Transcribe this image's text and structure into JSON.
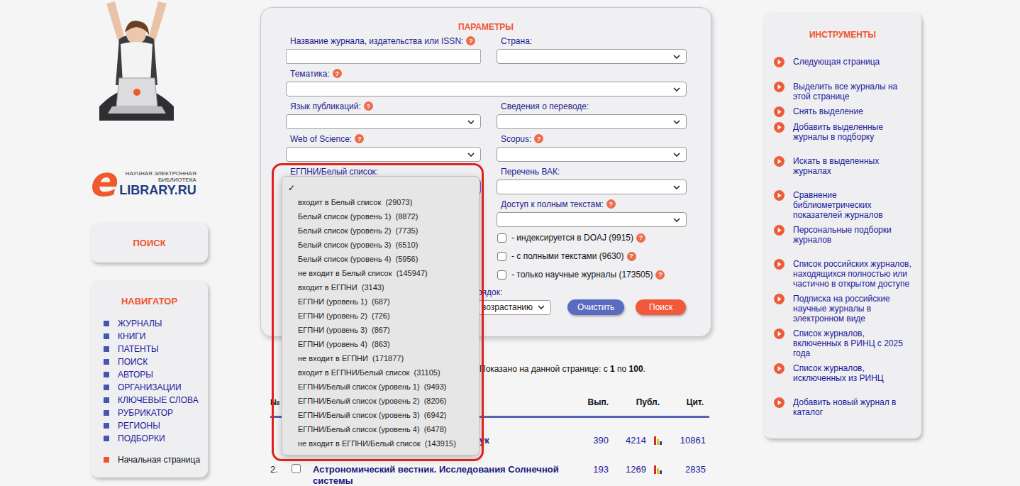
{
  "logo": {
    "letter": "e",
    "tagline": [
      "НАУЧНАЯ ЭЛЕКТРОННАЯ",
      "БИБЛИОТЕКА"
    ],
    "name": "LIBRARY.RU"
  },
  "search_panel": {
    "label": "ПОИСК"
  },
  "navigator": {
    "title": "НАВИГАТОР",
    "items": [
      "ЖУРНАЛЫ",
      "КНИГИ",
      "ПАТЕНТЫ",
      "ПОИСК",
      "АВТОРЫ",
      "ОРГАНИЗАЦИИ",
      "КЛЮЧЕВЫЕ СЛОВА",
      "РУБРИКАТОР",
      "РЕГИОНЫ",
      "ПОДБОРКИ"
    ],
    "home": "Начальная страница"
  },
  "parameters": {
    "title": "ПАРАМЕТРЫ",
    "help_icon": "?",
    "rows": [
      [
        {
          "label": "Название журнала, издательства или ISSN:",
          "help": true,
          "kind": "input",
          "value": "",
          "expanded": false
        },
        {
          "label": "Страна:",
          "help": false,
          "kind": "select",
          "value": "",
          "expanded": false
        }
      ],
      [
        {
          "label": "Тематика:",
          "help": true,
          "kind": "select",
          "value": "",
          "expanded": false
        }
      ],
      [
        {
          "label": "Язык публикаций:",
          "help": true,
          "kind": "select",
          "value": "",
          "expanded": false
        },
        {
          "label": "Сведения о переводе:",
          "help": false,
          "kind": "select",
          "value": "",
          "expanded": false
        }
      ],
      [
        {
          "label": "Web of Science:",
          "help": true,
          "kind": "select",
          "value": "",
          "expanded": false
        },
        {
          "label": "Scopus:",
          "help": true,
          "kind": "select",
          "value": "",
          "expanded": false
        }
      ],
      [
        {
          "label": "ЕГПНИ/Белый список:",
          "help": false,
          "kind": "select",
          "value": "",
          "expanded": true
        },
        {
          "label": "Перечень ВАК:",
          "help": false,
          "kind": "select",
          "value": "",
          "expanded": false
        }
      ],
      [
        null,
        {
          "label": "Доступ к полным текстам:",
          "help": true,
          "kind": "select",
          "value": "",
          "expanded": false
        }
      ]
    ],
    "checkboxes": [
      {
        "label": "- индексируется в DOAJ (9915)",
        "checked": false,
        "help": true
      },
      {
        "label": "- с полными текстами (9630)",
        "checked": false,
        "help": true
      },
      {
        "label": "- только научные журналы (173505)",
        "checked": false,
        "help": true
      }
    ],
    "sort": {
      "label": "рядок:",
      "value": "о возрастанию"
    },
    "buttons": [
      {
        "label": "Очистить",
        "color": "#5a6cc0"
      },
      {
        "label": "Поиск",
        "color": "#f2593a"
      }
    ]
  },
  "dropdown": {
    "check": "✓",
    "options": [
      {
        "label": "",
        "selected": true
      },
      {
        "label": "входит в Белый список  (29073)",
        "selected": false
      },
      {
        "label": "Белый список (уровень 1)  (8872)",
        "selected": false
      },
      {
        "label": "Белый список (уровень 2)  (7735)",
        "selected": false
      },
      {
        "label": "Белый список (уровень 3)  (6510)",
        "selected": false
      },
      {
        "label": "Белый список (уровень 4)  (5956)",
        "selected": false
      },
      {
        "label": "не входит в Белый список  (145947)",
        "selected": false
      },
      {
        "label": "входит в ЕГПНИ  (3143)",
        "selected": false
      },
      {
        "label": "ЕГПНИ (уровень 1)  (687)",
        "selected": false
      },
      {
        "label": "ЕГПНИ (уровень 2)  (726)",
        "selected": false
      },
      {
        "label": "ЕГПНИ (уровень 3)  (867)",
        "selected": false
      },
      {
        "label": "ЕГПНИ (уровень 4)  (863)",
        "selected": false
      },
      {
        "label": "не входит в ЕГПНИ  (171877)",
        "selected": false
      },
      {
        "label": "входит в ЕГПНИ/Белый список  (31105)",
        "selected": false
      },
      {
        "label": "ЕГПНИ/Белый список (уровень 1)  (9493)",
        "selected": false
      },
      {
        "label": "ЕГПНИ/Белый список (уровень 2)  (8206)",
        "selected": false
      },
      {
        "label": "ЕГПНИ/Белый список (уровень 3)  (6942)",
        "selected": false
      },
      {
        "label": "ЕГПНИ/Белый список (уровень 4)  (6478)",
        "selected": false
      },
      {
        "label": "не входит в ЕГПНИ/Белый список  (143915)",
        "selected": false
      }
    ]
  },
  "results": {
    "prefix": "Показано на данной странице: с ",
    "from": "1",
    "middle": " по ",
    "to": "100",
    "suffix": "."
  },
  "table": {
    "columns": [
      "№",
      "Вып.",
      "Публ.",
      "Цит."
    ],
    "rows": [
      {
        "num": "",
        "title": "ук",
        "issues": "390",
        "publications": "4214",
        "citations": "10861",
        "checked": false
      },
      {
        "num": "2.",
        "title": "Астрономический вестник. Исследования Солнечной системы",
        "issues": "193",
        "publications": "1269",
        "citations": "2835",
        "checked": false
      }
    ]
  },
  "tools": {
    "title": "ИНСТРУМЕНТЫ",
    "groups": [
      [
        "Следующая страница"
      ],
      [
        "Выделить все журналы на этой странице",
        "Снять выделение",
        "Добавить выделенные журналы в подборку"
      ],
      [
        "Искать в выделенных журналах"
      ],
      [
        "Сравнение библиометрических показателей журналов",
        "Персональные подборки журналов"
      ],
      [
        "Список российских журналов, находящихся полностью или частично в открытом доступе",
        "Подписка на российские научные журналы в электронном виде",
        "Список журналов, включенных в РИНЦ с 2025 года",
        "Список журналов, исключенных из РИНЦ"
      ],
      [
        "Добавить новый журнал в каталог"
      ]
    ]
  }
}
